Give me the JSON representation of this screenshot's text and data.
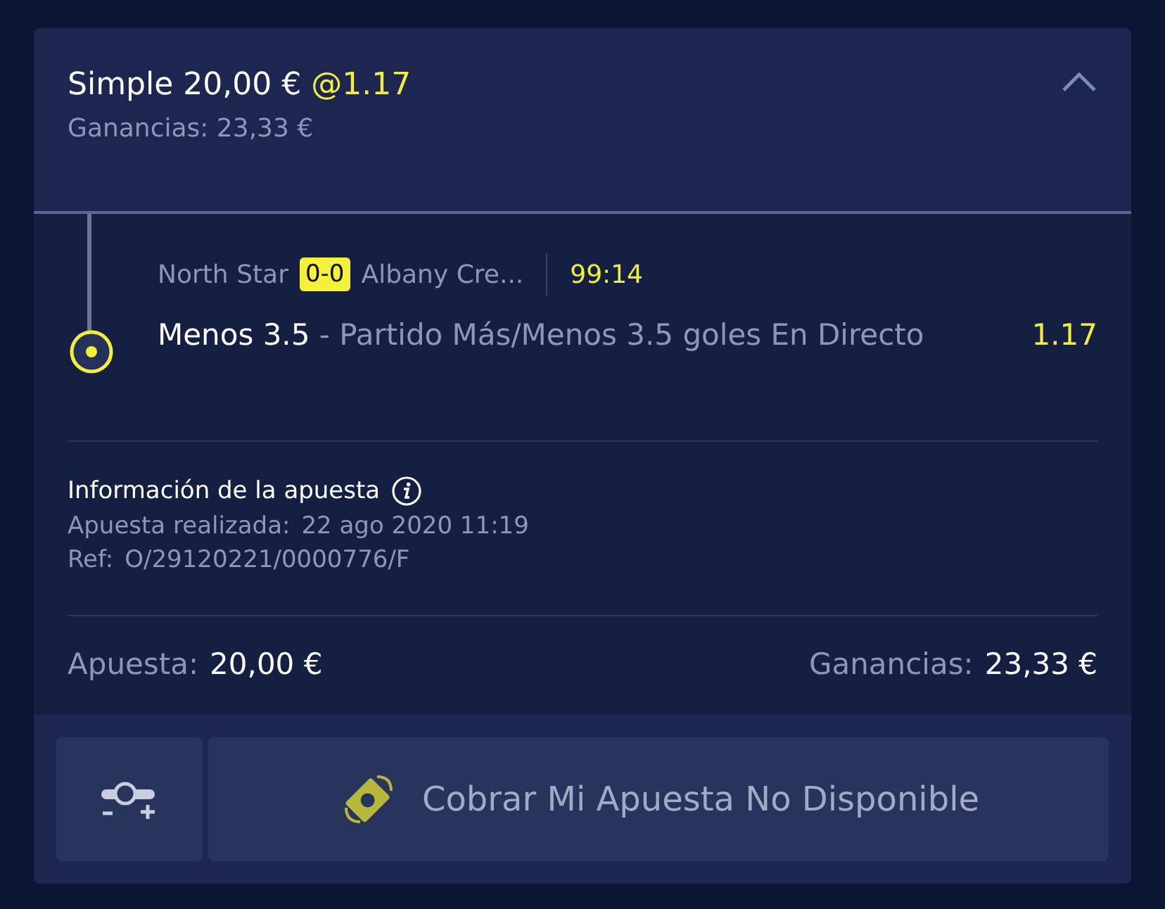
{
  "header": {
    "bet_type": "Simple",
    "stake": "20,00 €",
    "odds": "@1.17",
    "returns": "Ganancias: 23,33 €",
    "expanded": true
  },
  "leg": {
    "home": "North Star",
    "score": "0-0",
    "away": "Albany Cre...",
    "clock": "99:14",
    "selection": "Menos 3.5",
    "market": "- Partido Más/Menos 3.5 goles En Directo",
    "odds": "1.17"
  },
  "info": {
    "title": "Información de la apuesta",
    "placed_label": "Apuesta realizada:",
    "placed_value": "22 ago 2020 11:19",
    "ref_label": "Ref:",
    "ref_value": "O/29120221/0000776/F"
  },
  "totals": {
    "stake_label": "Apuesta:",
    "stake_value": "20,00 €",
    "returns_label": "Ganancias:",
    "returns_value": "23,33 €"
  },
  "actions": {
    "cash_out": {
      "label": "Cobrar Mi Apuesta No Disponible",
      "disabled": true
    }
  }
}
